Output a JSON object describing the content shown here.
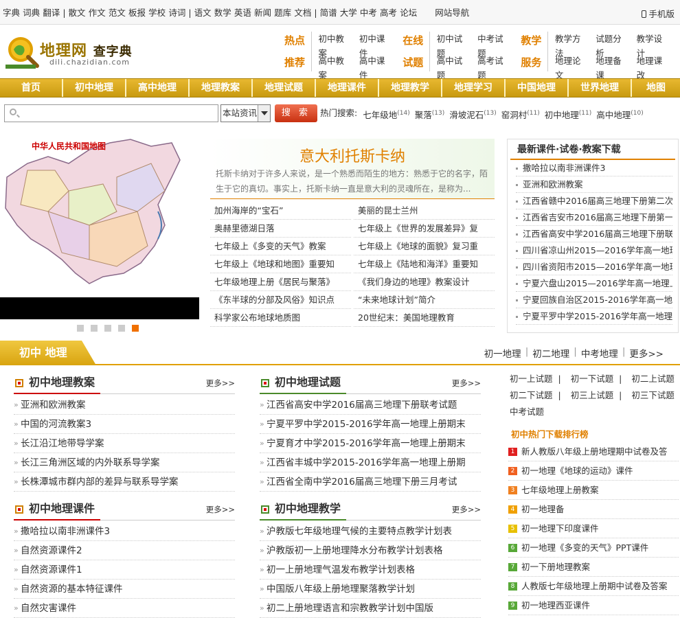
{
  "topbar": {
    "group1": [
      "字典",
      "词典",
      "翻译"
    ],
    "group2": [
      "散文",
      "作文",
      "范文",
      "板报",
      "学校",
      "诗词"
    ],
    "group3": [
      "语文",
      "数学",
      "英语",
      "新闻",
      "题库",
      "文档"
    ],
    "group4": [
      "简谱",
      "大学",
      "中考",
      "高考",
      "论坛"
    ],
    "nav_guide": "网站导航",
    "mobile": "手机版"
  },
  "logo": {
    "name": "地理网",
    "sub": "查字典",
    "url": "dili.chazidian.com"
  },
  "quick": [
    {
      "t1": "热点",
      "t2": "推荐",
      "links": [
        "初中教案",
        "初中课件",
        "高中教案",
        "高中课件"
      ]
    },
    {
      "t1": "在线",
      "t2": "试题",
      "links": [
        "初中试题",
        "中考试题",
        "高中试题",
        "高考试题"
      ]
    },
    {
      "t1": "教学",
      "t2": "服务",
      "links": [
        "教学方法",
        "试题分析",
        "教学设计",
        "地理论文",
        "地理备课",
        "地理课改"
      ]
    }
  ],
  "nav": [
    "首页",
    "初中地理",
    "高中地理",
    "地理教案",
    "地理试题",
    "地理课件",
    "地理教学",
    "地理学习",
    "中国地理",
    "世界地理",
    "地图"
  ],
  "search": {
    "select": "本站资讯",
    "button": "搜 索",
    "hot_label": "热门搜索:",
    "hot": [
      {
        "t": "七年级地",
        "n": "(14)"
      },
      {
        "t": "聚落",
        "n": "(13)"
      },
      {
        "t": "滑坡泥石",
        "n": "(13)"
      },
      {
        "t": "窑洞村",
        "n": "(11)"
      },
      {
        "t": "初中地理",
        "n": "(11)"
      },
      {
        "t": "高中地理",
        "n": "(10)"
      }
    ]
  },
  "banner": {
    "map_title": "中华人民共和国地图"
  },
  "feature": {
    "title": "意大利托斯卡纳",
    "desc": "托斯卡纳对于许多人来说，是一个熟悉而陌生的地方：熟悉于它的名字，陌生于它的真切。事实上，托斯卡纳一直是意大利的灵魂所在，是称为...",
    "items": [
      "加州海岸的“宝石”",
      "美丽的昆士兰州",
      "奥赫里德湖日落",
      "七年级上《世界的发展差异》复",
      "七年级上《多变的天气》教案",
      "七年级上《地球的面貌》复习重",
      "七年级上《地球和地图》重要知",
      "七年级上《陆地和海洋》重要知",
      "七年级地理上册《居民与聚落》",
      "《我们身边的地理》教案设计",
      "《东半球的分部及风俗》知识点",
      "“未来地球计划”简介",
      "科学家公布地球地质图",
      "20世纪末：美国地理教育"
    ]
  },
  "latest": {
    "title": "最新课件·试卷·教案下载",
    "items": [
      "撒哈拉以南非洲课件3",
      "亚洲和欧洲教案",
      "江西省赣中2016届高三地理下册第二次",
      "江西省吉安市2016届高三地理下册第一",
      "江西省高安中学2016届高三地理下册联",
      "四川省凉山州2015—2016学年高一地理",
      "四川省资阳市2015—2016学年高一地理",
      "宁夏六盘山2015—2016学年高一地理上",
      "宁夏回族自治区2015-2016学年高一地理",
      "宁夏平罗中学2015-2016学年高一地理上"
    ]
  },
  "section": {
    "tab": "初中  地理",
    "links": [
      "初一地理",
      "初二地理",
      "中考地理",
      "更多>>"
    ]
  },
  "blocks": [
    {
      "title": "初中地理教案",
      "more": "更多>>",
      "items": [
        "亚洲和欧洲教案",
        "中国的河流教案3",
        "长江沿江地带导学案",
        "长江三角洲区域的内外联系导学案",
        "长株潭城市群内部的差异与联系导学案"
      ]
    },
    {
      "title": "初中地理试题",
      "more": "更多>>",
      "items": [
        "江西省高安中学2016届高三地理下册联考试题",
        "宁夏平罗中学2015-2016学年高一地理上册期末",
        "宁夏育才中学2015-2016学年高一地理上册期末",
        "江西省丰城中学2015-2016学年高一地理上册期",
        "江西省全南中学2016届高三地理下册三月考试"
      ]
    },
    {
      "title": "初中地理课件",
      "more": "更多>>",
      "items": [
        "撒哈拉以南非洲课件3",
        "自然资源课件2",
        "自然资源课件1",
        "自然资源的基本特征课件",
        "自然灾害课件"
      ]
    },
    {
      "title": "初中地理教学",
      "more": "更多>>",
      "items": [
        "沪教版七年级地理气候的主要特点教学计划表",
        "沪教版初一上册地理降水分布教学计划表格",
        "初一上册地理气温发布教学计划表格",
        "中国版八年级上册地理聚落教学计划",
        "初二上册地理语言和宗教教学计划中国版"
      ]
    }
  ],
  "right": {
    "tests": [
      "初一上试题",
      "初一下试题",
      "初二上试题",
      "初二下试题",
      "初三上试题",
      "初三下试题",
      "中考试题"
    ],
    "rank_title": "初中热门下载排行榜",
    "rank": [
      {
        "n": "1",
        "t": "新人教版八年级上册地理期中试卷及答"
      },
      {
        "n": "2",
        "t": "初一地理《地球的运动》课件"
      },
      {
        "n": "3",
        "t": "七年级地理上册教案"
      },
      {
        "n": "4",
        "t": "初一地理备"
      },
      {
        "n": "5",
        "t": "初一地理下印度课件"
      },
      {
        "n": "6",
        "t": "初一地理《多变的天气》PPT课件"
      },
      {
        "n": "7",
        "t": "初一下册地理教案"
      },
      {
        "n": "8",
        "t": "人教版七年级地理上册期中试卷及答案"
      },
      {
        "n": "9",
        "t": "初一地理西亚课件"
      }
    ],
    "rank_colors": [
      "#e02020",
      "#f06020",
      "#f08020",
      "#f0a000",
      "#e8c000",
      "#58a838",
      "#58a838",
      "#58a838",
      "#58a838"
    ]
  }
}
